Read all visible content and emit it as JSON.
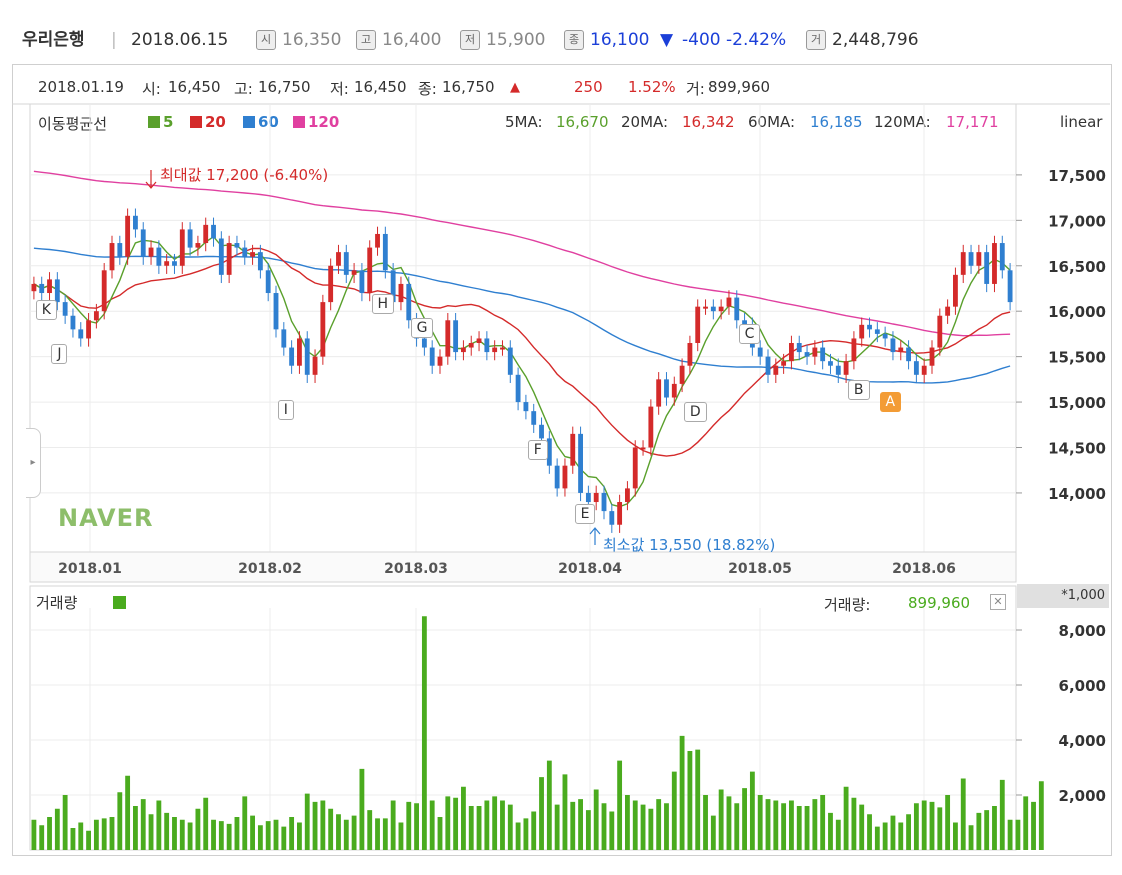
{
  "header": {
    "name": "우리은행",
    "date": "2018.06.15",
    "open_icon": "시",
    "open": "16,350",
    "high_icon": "고",
    "high": "16,400",
    "low_icon": "저",
    "low": "15,900",
    "close_icon": "종",
    "close": "16,100",
    "change_arrow": "▼",
    "change": "-400",
    "change_pct": "-2.42%",
    "volume_icon": "거",
    "volume": "2,448,796"
  },
  "info": {
    "date": "2018.01.19",
    "open_label": "시:",
    "open": "16,450",
    "high_label": "고:",
    "high": "16,750",
    "low_label": "저:",
    "low": "16,450",
    "close_label": "종:",
    "close": "16,750",
    "arrow": "▲",
    "change": "250",
    "change_pct": "1.52%",
    "volume_label": "거:",
    "volume": "899,960"
  },
  "ma": {
    "label": "이동평균선",
    "legend": [
      {
        "name": "5",
        "color": "#5aa02c"
      },
      {
        "name": "20",
        "color": "#d42a2a"
      },
      {
        "name": "60",
        "color": "#2f7fd0"
      },
      {
        "name": "120",
        "color": "#e040a0"
      }
    ],
    "values": [
      {
        "label": "5MA:",
        "value": "16,670",
        "color": "#5aa02c"
      },
      {
        "label": "20MA:",
        "value": "16,342",
        "color": "#d42a2a"
      },
      {
        "label": "60MA:",
        "value": "16,185",
        "color": "#2f7fd0"
      },
      {
        "label": "120MA:",
        "value": "17,171",
        "color": "#e040a0"
      }
    ],
    "scale": "linear"
  },
  "watermark": "NAVER",
  "volume_panel": {
    "label": "거래량",
    "value_label": "거래량:",
    "value": "899,960",
    "unit": "*1,000",
    "close_icon": "close-icon"
  },
  "chart_data": {
    "type": "candlestick",
    "x_labels": [
      "2018.01",
      "2018.02",
      "2018.03",
      "2018.04",
      "2018.05",
      "2018.06"
    ],
    "y_ticks": [
      "17,500",
      "17,000",
      "16,500",
      "16,000",
      "15,500",
      "15,000",
      "14,500",
      "14,000"
    ],
    "y_tick_values": [
      17500,
      17000,
      16500,
      16000,
      15500,
      15000,
      14500,
      14000
    ],
    "ylim": [
      13350,
      17950
    ],
    "max_annotation": "최대값 17,200 (-6.40%)",
    "min_annotation": "최소값 13,550 (18.82%)",
    "close": [
      16300,
      16200,
      16350,
      16100,
      15950,
      15800,
      15700,
      15900,
      16000,
      16450,
      16750,
      16600,
      17050,
      16900,
      16600,
      16700,
      16500,
      16550,
      16500,
      16900,
      16700,
      16750,
      16950,
      16800,
      16400,
      16750,
      16700,
      16600,
      16650,
      16450,
      16200,
      15800,
      15600,
      15400,
      15700,
      15300,
      15500,
      16100,
      16500,
      16650,
      16400,
      16450,
      16200,
      16700,
      16850,
      16450,
      16100,
      16300,
      15900,
      15700,
      15600,
      15400,
      15500,
      15900,
      15550,
      15600,
      15650,
      15700,
      15550,
      15600,
      15600,
      15300,
      15000,
      14900,
      14750,
      14600,
      14300,
      14050,
      14300,
      14650,
      14000,
      13900,
      14000,
      13800,
      13650,
      13900,
      14050,
      14500,
      14500,
      14950,
      15250,
      15050,
      15200,
      15400,
      15650,
      16050,
      16050,
      16000,
      16050,
      16150,
      15900,
      15850,
      15600,
      15500,
      15300,
      15400,
      15450,
      15650,
      15550,
      15500,
      15600,
      15450,
      15400,
      15300,
      15450,
      15700,
      15850,
      15800,
      15750,
      15700,
      15550,
      15600,
      15450,
      15300,
      15400,
      15600,
      15950,
      16050,
      16400,
      16650,
      16500,
      16650,
      16300,
      16750,
      16450,
      16100
    ],
    "volume": [
      1100,
      900,
      1200,
      1500,
      2000,
      800,
      1000,
      700,
      1100,
      1150,
      1200,
      2100,
      2700,
      1600,
      1850,
      1300,
      1800,
      1350,
      1200,
      1100,
      1000,
      1500,
      1900,
      1100,
      1050,
      950,
      1200,
      1950,
      1250,
      900,
      1050,
      1100,
      850,
      1200,
      1000,
      2050,
      1750,
      1800,
      1500,
      1300,
      1100,
      1250,
      2950,
      1450,
      1150,
      1150,
      1800,
      1000,
      1750,
      1700,
      8500,
      1800,
      1200,
      1950,
      1900,
      2300,
      1600,
      1600,
      1800,
      1950,
      1800,
      1650,
      1000,
      1150,
      1400,
      2650,
      3250,
      1650,
      2750,
      1750,
      1850,
      1450,
      2200,
      1700,
      1400,
      3250,
      2000,
      1800,
      1650,
      1500,
      1850,
      1700,
      2850,
      4150,
      3600,
      3650,
      2000,
      1250,
      2200,
      1950,
      1700,
      2250,
      2850,
      2000,
      1850,
      1800,
      1700,
      1800,
      1600,
      1600,
      1850,
      2000,
      1350,
      1100,
      2300,
      1900,
      1650,
      1300,
      850,
      1000,
      1250,
      1000,
      1300,
      1700,
      1800,
      1750,
      1550,
      2000,
      1000,
      2600,
      900,
      1350,
      1450,
      1600,
      2550,
      1100,
      1100,
      1950,
      1750,
      2500
    ],
    "volume_ticks": [
      "8,000",
      "6,000",
      "4,000",
      "2,000"
    ],
    "volume_tick_values": [
      8000,
      6000,
      4000,
      2000
    ],
    "volume_ylim": [
      0,
      8800
    ],
    "markers": [
      {
        "label": "K",
        "index": 1
      },
      {
        "label": "J",
        "index": 3
      },
      {
        "label": "I",
        "index": 32
      },
      {
        "label": "H",
        "index": 44
      },
      {
        "label": "G",
        "index": 49
      },
      {
        "label": "F",
        "index": 64
      },
      {
        "label": "E",
        "index": 70
      },
      {
        "label": "D",
        "index": 84
      },
      {
        "label": "C",
        "index": 91
      },
      {
        "label": "B",
        "index": 105
      },
      {
        "label": "A",
        "index": 107
      }
    ],
    "colors": {
      "up": "#d42a2a",
      "down": "#2f7fd0",
      "ma5": "#5aa02c",
      "ma20": "#d42a2a",
      "ma60": "#2f7fd0",
      "ma120": "#e040a0",
      "volume": "#4aab1e"
    }
  }
}
